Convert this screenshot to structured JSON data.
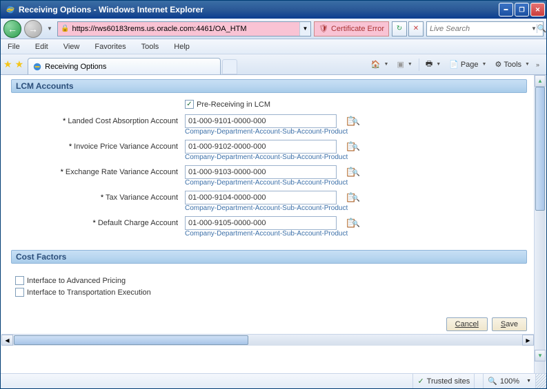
{
  "window": {
    "title": "Receiving Options - Windows Internet Explorer"
  },
  "address": {
    "url": "https://rws60183rems.us.oracle.com:4461/OA_HTM",
    "cert_error": "Certificate Error"
  },
  "search": {
    "placeholder": "Live Search"
  },
  "menubar": [
    "File",
    "Edit",
    "View",
    "Favorites",
    "Tools",
    "Help"
  ],
  "tab": {
    "title": "Receiving Options"
  },
  "cmdbar": {
    "page": "Page",
    "tools": "Tools"
  },
  "sections": {
    "lcm": {
      "title": "LCM Accounts",
      "pre_receiving_label": "Pre-Receiving in LCM",
      "pre_receiving_checked": true,
      "hint": "Company-Department-Account-Sub-Account-Product",
      "fields": [
        {
          "label": "Landed Cost Absorption Account",
          "value": "01-000-9101-0000-000"
        },
        {
          "label": "Invoice Price Variance Account",
          "value": "01-000-9102-0000-000"
        },
        {
          "label": "Exchange Rate Variance Account",
          "value": "01-000-9103-0000-000"
        },
        {
          "label": "Tax Variance Account",
          "value": "01-000-9104-0000-000"
        },
        {
          "label": "Default Charge Account",
          "value": "01-000-9105-0000-000"
        }
      ]
    },
    "cost": {
      "title": "Cost Factors",
      "interface_pricing": "Interface to Advanced Pricing",
      "interface_transport": "Interface to Transportation Execution"
    }
  },
  "buttons": {
    "cancel": "Cancel",
    "save_prefix": "S",
    "save_rest": "ave"
  },
  "status": {
    "trusted": "Trusted sites",
    "zoom": "100%"
  }
}
